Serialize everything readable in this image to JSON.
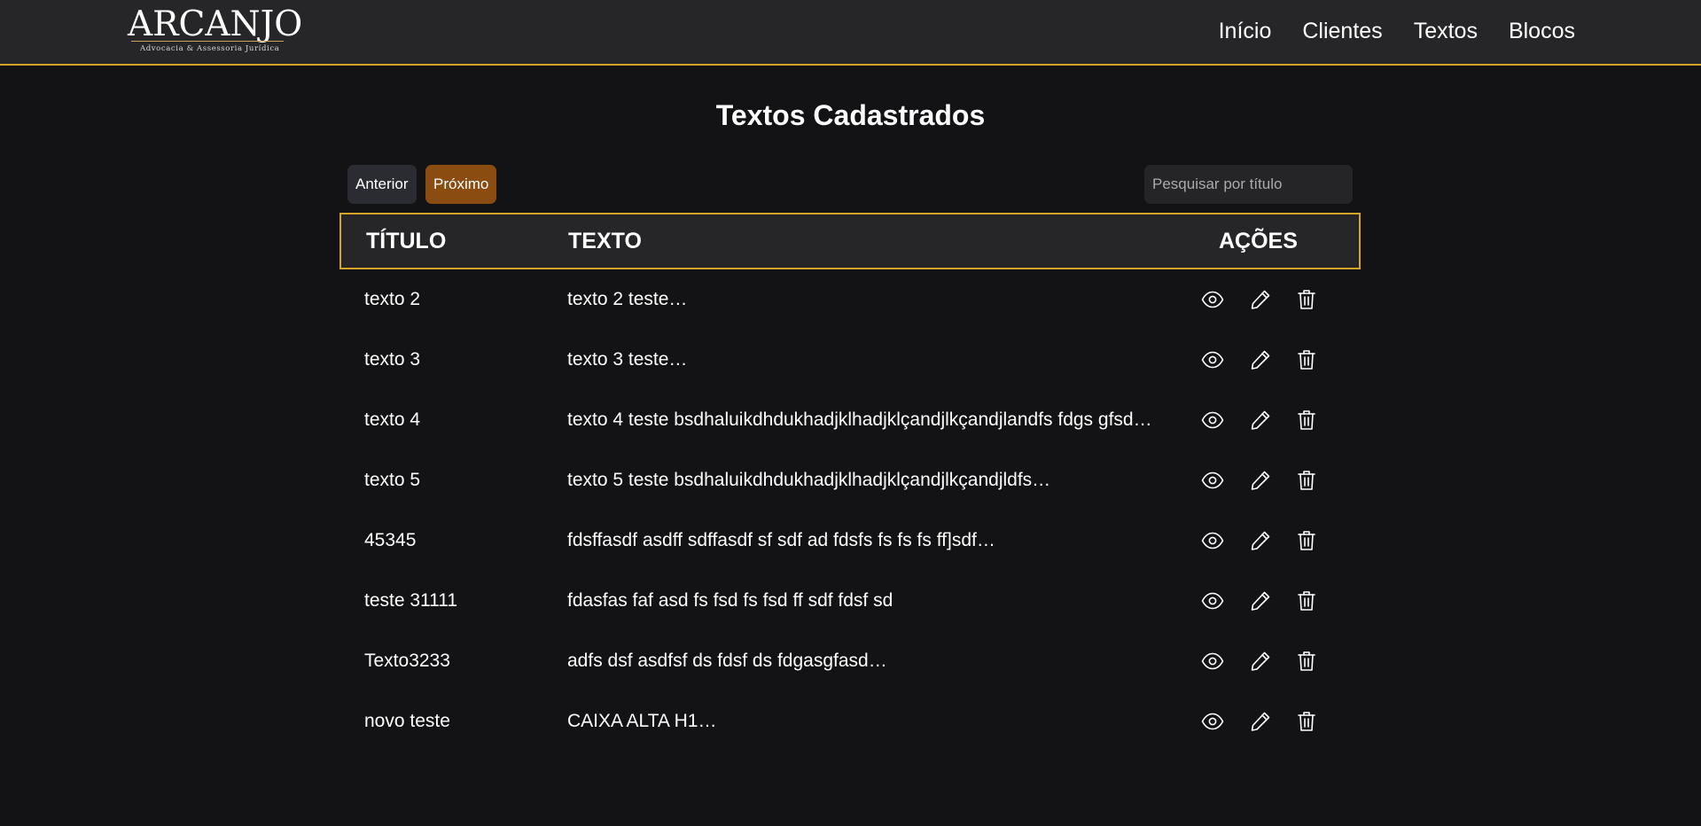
{
  "brand": {
    "name": "ARCANJO",
    "tagline": "Advocacia & Assessoria Jurídica"
  },
  "nav": {
    "items": [
      "Início",
      "Clientes",
      "Textos",
      "Blocos"
    ]
  },
  "page": {
    "title": "Textos Cadastrados"
  },
  "pagination": {
    "prev_label": "Anterior",
    "next_label": "Próximo"
  },
  "search": {
    "placeholder": "Pesquisar por título",
    "value": ""
  },
  "table": {
    "columns": [
      "TÍTULO",
      "TEXTO",
      "AÇÕES"
    ],
    "rows": [
      {
        "title": "texto 2",
        "text": "texto 2 teste…"
      },
      {
        "title": "texto 3",
        "text": "texto 3 teste…"
      },
      {
        "title": "texto 4",
        "text": "texto 4 teste bsdhaluikdhdukhadjklhadjklçandjlkçandjlandfs fdgs gfsd…"
      },
      {
        "title": "texto 5",
        "text": "texto 5 teste bsdhaluikdhdukhadjklhadjklçandjlkçandjldfs…"
      },
      {
        "title": "45345",
        "text": "fdsffasdf asdff sdffasdf sf sdf ad fdsfs fs fs fs ff]sdf…"
      },
      {
        "title": "teste 31111",
        "text": "fdasfas faf asd fs fsd fs fsd ff sdf fdsf sd"
      },
      {
        "title": "Texto3233",
        "text": "adfs dsf asdfsf ds fdsf ds fdgasgfasd…"
      },
      {
        "title": "novo teste",
        "text": "CAIXA ALTA H1…"
      }
    ],
    "action_icons": [
      "eye-icon",
      "pencil-icon",
      "trash-icon"
    ]
  },
  "colors": {
    "background": "#131315",
    "header": "#262628",
    "accent_gold": "#d4a32a",
    "next_button": "#8a4c10",
    "prev_button": "#2b2b32"
  }
}
